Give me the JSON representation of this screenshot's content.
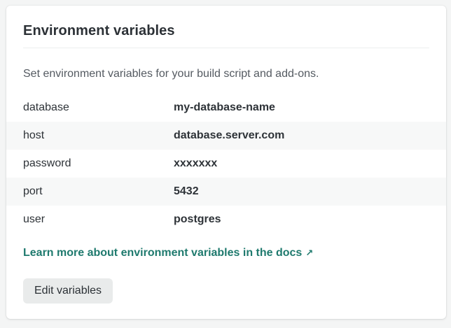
{
  "card": {
    "title": "Environment variables",
    "description": "Set environment variables for your build script and add-ons."
  },
  "variables": [
    {
      "key": "database",
      "value": "my-database-name"
    },
    {
      "key": "host",
      "value": "database.server.com"
    },
    {
      "key": "password",
      "value": "xxxxxxx"
    },
    {
      "key": "port",
      "value": "5432"
    },
    {
      "key": "user",
      "value": "postgres"
    }
  ],
  "docs_link": {
    "label": "Learn more about environment variables in the docs",
    "icon": "external-arrow-icon",
    "color": "#1f7a6e"
  },
  "actions": {
    "edit_label": "Edit variables"
  }
}
